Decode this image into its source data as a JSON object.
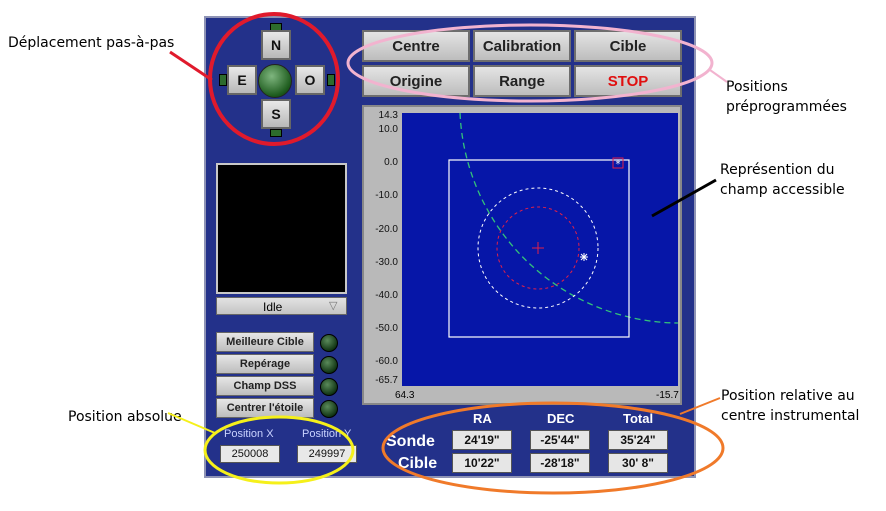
{
  "annotations": {
    "deplacement": "Déplacement pas-à-pas",
    "positions_prog_1": "Positions",
    "positions_prog_2": "préprogrammées",
    "representation_1": "Représention du",
    "representation_2": "champ accessible",
    "position_absolue": "Position absolue",
    "position_relative_1": "Position relative au",
    "position_relative_2": "centre instrumental"
  },
  "colors": {
    "panel": "#23318a",
    "plot_bg": "#0616a8",
    "annot_red": "#e01a2c",
    "annot_pink": "#f2b3cf",
    "annot_yellow": "#f5f01a",
    "annot_orange": "#f07a2a"
  },
  "compass": {
    "n": "N",
    "s": "S",
    "e": "E",
    "o": "O"
  },
  "preset_buttons": {
    "centre": "Centre",
    "calibration": "Calibration",
    "cible": "Cible",
    "origine": "Origine",
    "range": "Range",
    "stop": "STOP"
  },
  "camera": {
    "status": "Idle"
  },
  "actions": {
    "meilleure_cible": "Meilleure Cible",
    "reperage": "Repérage",
    "champ_dss": "Champ DSS",
    "centrer_etoile": "Centrer l'étoile"
  },
  "absolute": {
    "x_label": "Position X",
    "y_label": "Position Y",
    "x_value": "250008",
    "y_value": "249997"
  },
  "relative": {
    "headers": {
      "ra": "RA",
      "dec": "DEC",
      "total": "Total"
    },
    "rows": {
      "sonde": "Sonde",
      "cible": "Cible"
    },
    "sonde": {
      "ra": "24'19\"",
      "dec": "-25'44\"",
      "total": "35'24\""
    },
    "cible": {
      "ra": "10'22\"",
      "dec": "-28'18\"",
      "total": "30' 8\""
    }
  },
  "plot": {
    "y_ticks": [
      "14.3",
      "10.0",
      "0.0",
      "-10.0",
      "-20.0",
      "-30.0",
      "-40.0",
      "-50.0",
      "-60.0",
      "-65.7"
    ],
    "x_left": "64.3",
    "x_right": "-15.7"
  }
}
